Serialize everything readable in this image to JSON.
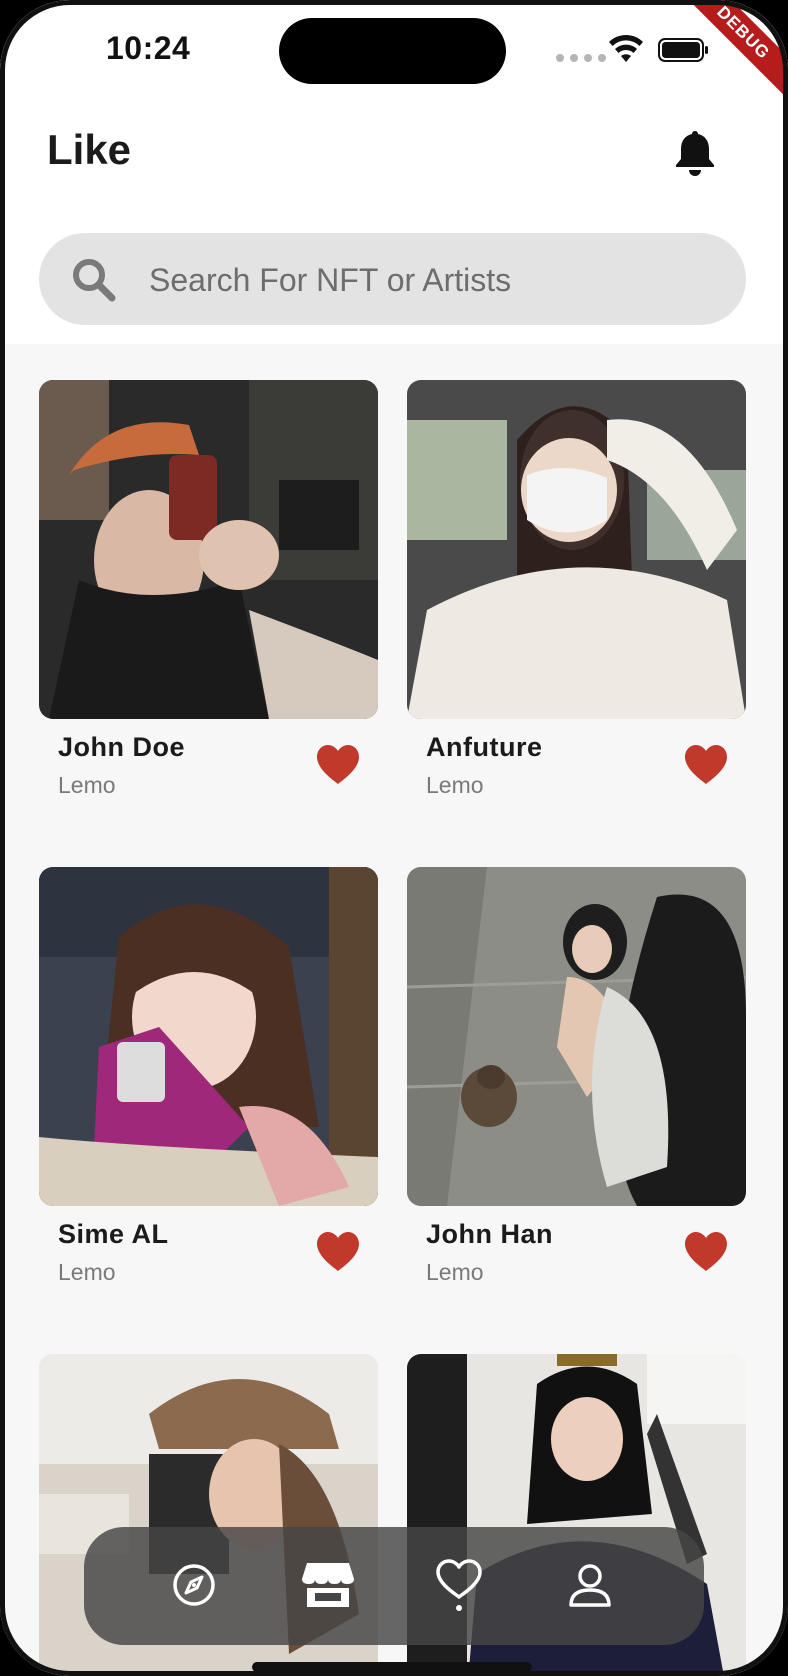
{
  "status_bar": {
    "time": "10:24"
  },
  "debug_banner": {
    "label": "DEBUG"
  },
  "header": {
    "title": "Like"
  },
  "search": {
    "placeholder": "Search For NFT or Artists"
  },
  "cards": [
    {
      "name": "John Doe",
      "artist": "Lemo",
      "liked": true
    },
    {
      "name": "Anfuture",
      "artist": "Lemo",
      "liked": true
    },
    {
      "name": "Sime AL",
      "artist": "Lemo",
      "liked": true
    },
    {
      "name": "John Han",
      "artist": "Lemo",
      "liked": true
    },
    {
      "name": "",
      "artist": "",
      "liked": false
    },
    {
      "name": "",
      "artist": "",
      "liked": false
    }
  ],
  "bottom_nav": {
    "items": [
      {
        "icon": "compass-icon",
        "active": false
      },
      {
        "icon": "store-icon",
        "active": false
      },
      {
        "icon": "heart-outline-icon",
        "active": true
      },
      {
        "icon": "profile-icon",
        "active": false
      }
    ]
  },
  "colors": {
    "accent_heart": "#c0392b",
    "search_bg": "#e3e3e3",
    "navbar_bg": "#464646",
    "debug_banner": "#b71c1c"
  }
}
